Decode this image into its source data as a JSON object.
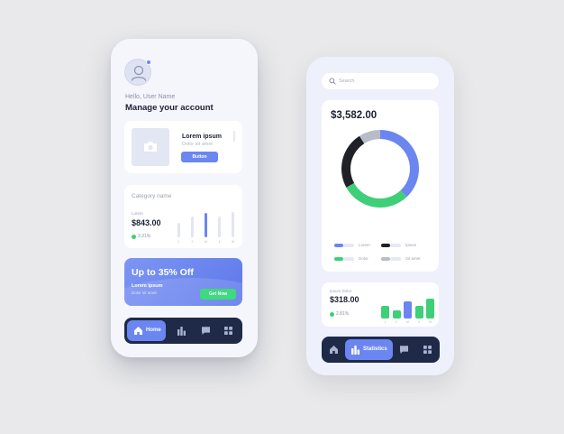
{
  "colors": {
    "accent": "#6b86f0",
    "green": "#3ecf78",
    "dark": "#1e2a48",
    "gray": "#b8bcc8",
    "black": "#1f2126"
  },
  "profile": {
    "avatar_icon": "user-icon",
    "greeting": "Hello, User Name",
    "title": "Manage your account"
  },
  "product_card": {
    "image_icon": "camera-icon",
    "title": "Lorem ipsum",
    "subtitle": "Dolor sit amet",
    "button_label": "Button"
  },
  "category_card": {
    "title": "Category name",
    "label": "Lorem",
    "amount": "$843.00",
    "change": "3.31%",
    "bars": [
      {
        "value": 0.45,
        "label": "1",
        "active": false
      },
      {
        "value": 0.65,
        "label": "2",
        "active": false
      },
      {
        "value": 0.75,
        "label": "M",
        "active": true
      },
      {
        "value": 0.65,
        "label": "4",
        "active": false
      },
      {
        "value": 0.78,
        "label": "W",
        "active": false
      }
    ]
  },
  "promo": {
    "title": "Up to 35% Off",
    "subtitle": "Lorem ipsum",
    "caption": "Dolor sit amet",
    "button_label": "Get Now"
  },
  "nav_left": {
    "active_label": "Home",
    "active_icon": "home-icon",
    "items": [
      "bar-chart-icon",
      "chat-icon",
      "grid-icon"
    ]
  },
  "search": {
    "placeholder": "Search",
    "icon": "search-icon"
  },
  "donut_card": {
    "total": "$3,582.00",
    "legend": [
      {
        "label": "Lorem",
        "color": "#6b86f0"
      },
      {
        "label": "Ipsum",
        "color": "#1f2126"
      },
      {
        "label": "Dolor",
        "color": "#3ecf78"
      },
      {
        "label": "Sit amet",
        "color": "#b8bcc8"
      }
    ]
  },
  "chart_data": [
    {
      "type": "pie",
      "title": "$3,582.00",
      "series": [
        {
          "name": "Lorem",
          "value": 38
        },
        {
          "name": "Dolor",
          "value": 29
        },
        {
          "name": "Ipsum",
          "value": 24
        },
        {
          "name": "Sit amet",
          "value": 9
        }
      ]
    },
    {
      "type": "bar",
      "categories": [
        "1",
        "2",
        "M",
        "4",
        "W"
      ],
      "values": [
        0.55,
        0.35,
        0.75,
        0.55,
        0.85
      ],
      "colors": [
        "#3ecf78",
        "#3ecf78",
        "#6b86f0",
        "#3ecf78",
        "#3ecf78"
      ]
    }
  ],
  "stats_card": {
    "label": "Ipsum Dolor",
    "amount": "$318.00",
    "change": "2.81%"
  },
  "nav_right": {
    "active_label": "Statistics",
    "active_icon": "bar-chart-icon",
    "items": [
      "home-icon",
      "chat-icon",
      "grid-icon"
    ]
  }
}
